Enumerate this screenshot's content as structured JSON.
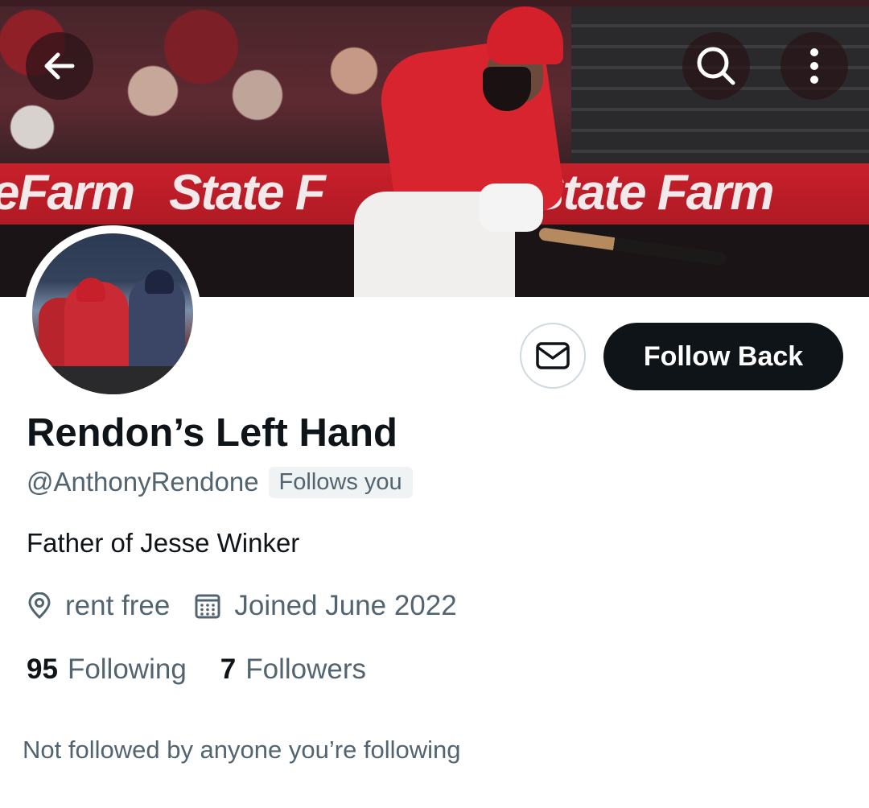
{
  "banner": {
    "ad_text_left": "eFarm",
    "ad_text_mid": "State F",
    "ad_text_right": "State Farm"
  },
  "icons": {
    "back": "back-arrow-icon",
    "search": "search-icon",
    "more": "more-vertical-icon",
    "message": "envelope-icon",
    "location": "location-pin-icon",
    "calendar": "calendar-icon"
  },
  "profile": {
    "display_name": "Rendon’s Left Hand",
    "handle": "@AnthonyRendone",
    "follows_you_label": "Follows you",
    "bio": "Father of Jesse Winker",
    "location": "rent free",
    "joined": "Joined June 2022",
    "following_count": "95",
    "following_label": "Following",
    "followers_count": "7",
    "followers_label": "Followers",
    "mutuals_note": "Not followed by anyone you’re following"
  },
  "actions": {
    "follow_back_label": "Follow Back"
  },
  "colors": {
    "text_primary": "#0f1419",
    "text_secondary": "#536471",
    "badge_bg": "#eff3f4",
    "button_dark": "#0f1419",
    "border": "#cfd9de"
  }
}
